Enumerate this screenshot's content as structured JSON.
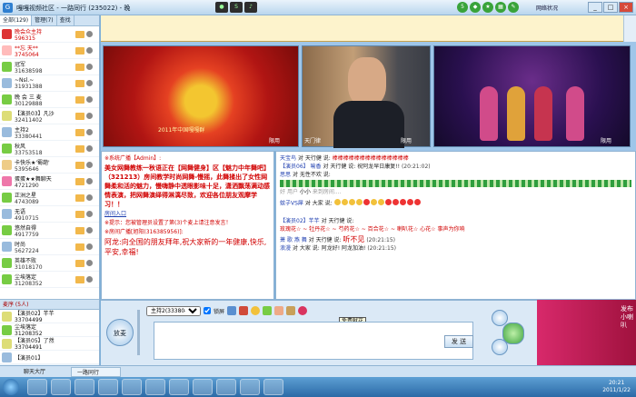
{
  "window": {
    "title": "嘎嘎视频社区 - 一路同行 (235022) - 晚",
    "network_status": "网络状况",
    "buttons": [
      "_",
      "□",
      "×"
    ]
  },
  "left": {
    "tabs": [
      "全部(129)",
      "管理(7)",
      "查找"
    ],
    "users": [
      {
        "name": "晚会众主持",
        "id": "596315",
        "red": true,
        "color": "#d33"
      },
      {
        "name": "**忘 天**",
        "id": "3745064",
        "red": true,
        "color": "#fbb"
      },
      {
        "name": "冠军",
        "id": "31638598",
        "red": false,
        "color": "#7c4"
      },
      {
        "name": "~Nsl.~",
        "id": "31931388",
        "red": false,
        "color": "#9bd"
      },
      {
        "name": "晚 会 三 麦",
        "id": "30129888",
        "red": false,
        "color": "#7c4"
      },
      {
        "name": "【演员03】凡沙",
        "id": "32411402",
        "red": false,
        "color": "#dd7"
      },
      {
        "name": "主持2",
        "id": "33380441",
        "red": false,
        "color": "#9bd"
      },
      {
        "name": "秋风",
        "id": "33753518",
        "red": false,
        "color": "#7c4"
      },
      {
        "name": "卡快乐★'蜀葩'",
        "id": "5395646",
        "red": false,
        "color": "#ec8"
      },
      {
        "name": "蛋蛋★★舞聊天",
        "id": "4721290",
        "red": false,
        "color": "#e7a"
      },
      {
        "name": "正洲之星",
        "id": "4743089",
        "red": false,
        "color": "#7c4"
      },
      {
        "name": "无语",
        "id": "4910715",
        "red": false,
        "color": "#9bd"
      },
      {
        "name": "悠然自得",
        "id": "4917759",
        "red": false,
        "color": "#7c4"
      },
      {
        "name": "时尚",
        "id": "5627224",
        "red": false,
        "color": "#9bd"
      },
      {
        "name": "英雄不败",
        "id": "31018170",
        "red": false,
        "color": "#7c4"
      },
      {
        "name": "尘埃落定",
        "id": "31208352",
        "red": false,
        "color": "#7c4"
      }
    ],
    "queue_title": "麦序 (5人)",
    "queue": [
      {
        "name": "【演员02】芊芊",
        "id": "33704499",
        "color": "#dd7"
      },
      {
        "name": "尘埃落定",
        "id": "31208352",
        "color": "#7c4"
      },
      {
        "name": "【演员05】了然",
        "id": "33704491",
        "color": "#dd7"
      },
      {
        "name": "【演员01】",
        "id": "",
        "color": "#9bd"
      }
    ]
  },
  "videos": {
    "labels": [
      "限用",
      "限用",
      "限用"
    ],
    "v1_caption": "2011年中国嘎嘎群",
    "v2_caption": "天门律"
  },
  "announce": {
    "sys_head": "※系统广播【Admin】:",
    "body": "美女网舞教练一秋语正在【网舞健身】区【魅力中年舞吧】（321213）房间教学时尚网舞-慢摇，此舞揉出了女性网舞柔和活的魅力，慢嗨静中透眼影味十足，潇洒飘荡满动感情表演，把网舞演绎得淋漓尽致，欢迎各位朋友观摩学习！！",
    "link": "房间入口",
    "hint": "※提示：您被管理员设置了第(3)个麦上请注意发言！",
    "room_head": "※房间广播[旭阳(316385956)]:",
    "room_msg": "阿龙:向全国的朋友拜年,祝大家新的一年健康,快乐,平安,幸福!"
  },
  "chat": {
    "lines": [
      {
        "who": "天宝鸟",
        "text": "对 天行健 说:",
        "extra": "棒棒棒棒棒棒棒棒棒棒棒棒棒棒"
      },
      {
        "who": "【演员06】 喻香",
        "text": "对 天行健 说:",
        "extra": "祝阿龙早日康复!!",
        "time": "(20:21:02)"
      },
      {
        "who": "思思",
        "text": "对 无性不欢 说:",
        "extra": "好"
      },
      {
        "who": "用户",
        "text": "小小",
        "extra": "来到房间...."
      },
      {
        "who": "蚊子VS犀",
        "text": "对 大家 说:",
        "extra": ""
      },
      {
        "who": "【演员02】芊芊",
        "text": "对 天行健 说:",
        "extra": "玫瑰花☆ ~ 牡丹花☆ ~ 芍药花☆ ~ 百合花☆ ~ 喇叭花☆ 心花☆ 事声为你响"
      },
      {
        "who": "萧 歌 燕 舞",
        "text": "对 天行健 说:",
        "extra": "听不见",
        "time": "(20:21:15)"
      },
      {
        "who": "浪漫",
        "text": "对 大家 说:",
        "extra": "阿龙好! 阿龙加油!",
        "time": "(20:21:15)"
      }
    ]
  },
  "toolbar": {
    "target": "主持2(33380441)",
    "lock_label": "锁屏",
    "flower_tooltip": "免费献花",
    "mic_button": "放麦",
    "send_button": "发 送"
  },
  "ad": {
    "text": "发布小喇叭"
  },
  "status": {
    "room_tab": "聊天大厅",
    "room_name": "一路同行"
  },
  "taskbar": {
    "time": "20:21",
    "date": "2011/1/22"
  }
}
